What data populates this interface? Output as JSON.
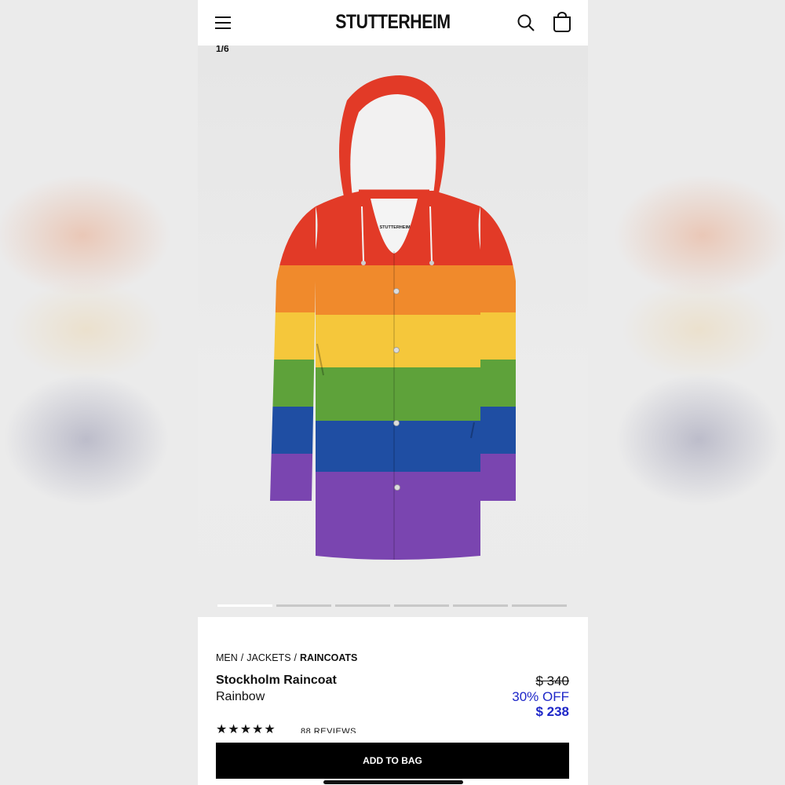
{
  "brand": "STUTTERHEIM",
  "gallery": {
    "counter": "1/6",
    "coat_label": "STUTTERHEIM",
    "slide_count": 6,
    "active_slide": 1
  },
  "breadcrumb": {
    "items": [
      "MEN",
      "JACKETS"
    ],
    "separator": "/",
    "current": "RAINCOATS"
  },
  "product": {
    "name": "Stockholm Raincoat",
    "color": "Rainbow",
    "price_original": "$ 340",
    "discount": "30% OFF",
    "price_sale": "$ 238",
    "rating_stars": "★★★★★",
    "rating_value": 4.5,
    "reviews": "88 REVIEWS"
  },
  "actions": {
    "add_to_bag": "ADD TO BAG"
  },
  "icons": {
    "menu": "hamburger-menu-icon",
    "search": "search-icon",
    "bag": "shopping-bag-icon"
  },
  "colors": {
    "sale_blue": "#1e27c8",
    "button_black": "#000000",
    "stripe_red": "#e23a27",
    "stripe_orange": "#f08a2c",
    "stripe_yellow": "#f5c73b",
    "stripe_green": "#5ea23a",
    "stripe_blue": "#1f4ea3",
    "stripe_purple": "#7a45b0"
  }
}
